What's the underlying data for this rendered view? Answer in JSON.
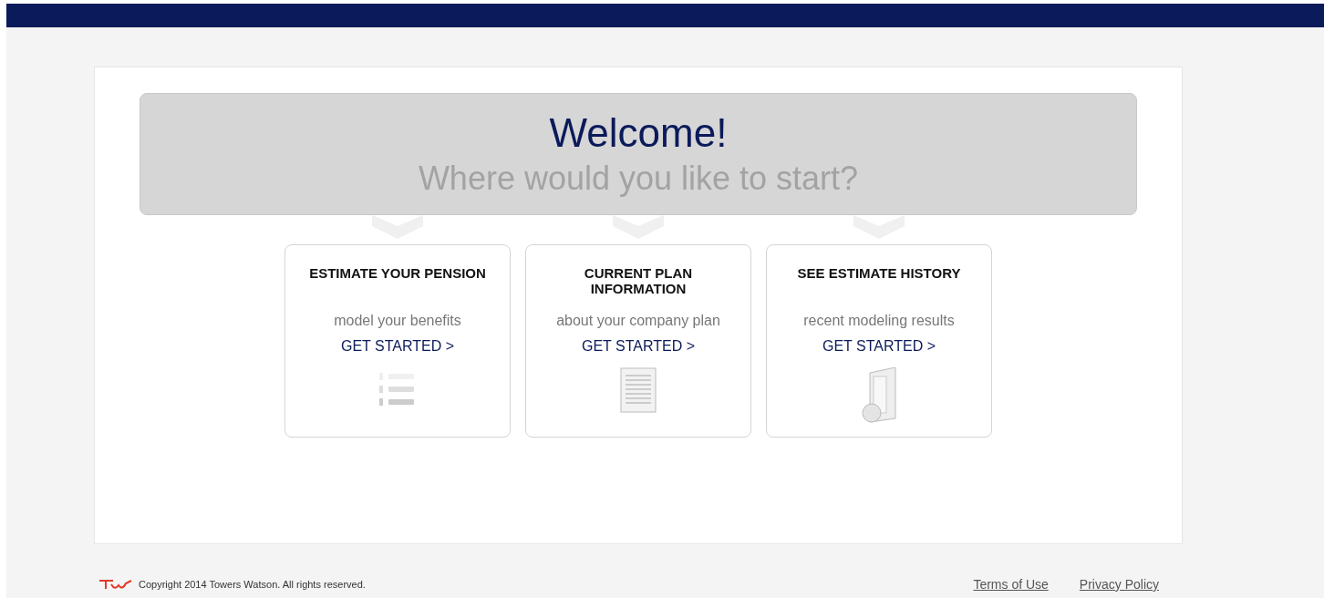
{
  "banner": {
    "title": "Welcome!",
    "subtitle": "Where would you like to start?"
  },
  "cards": [
    {
      "title": "ESTIMATE YOUR PENSION",
      "description": "model your benefits",
      "link": "GET STARTED >"
    },
    {
      "title": "CURRENT PLAN INFORMATION",
      "description": "about your company plan",
      "link": "GET STARTED >"
    },
    {
      "title": "SEE ESTIMATE HISTORY",
      "description": "recent modeling results",
      "link": "GET STARTED >"
    }
  ],
  "footer": {
    "copyright": "Copyright 2014 Towers Watson. All rights reserved.",
    "links": [
      "Terms of Use",
      "Privacy Policy"
    ]
  }
}
